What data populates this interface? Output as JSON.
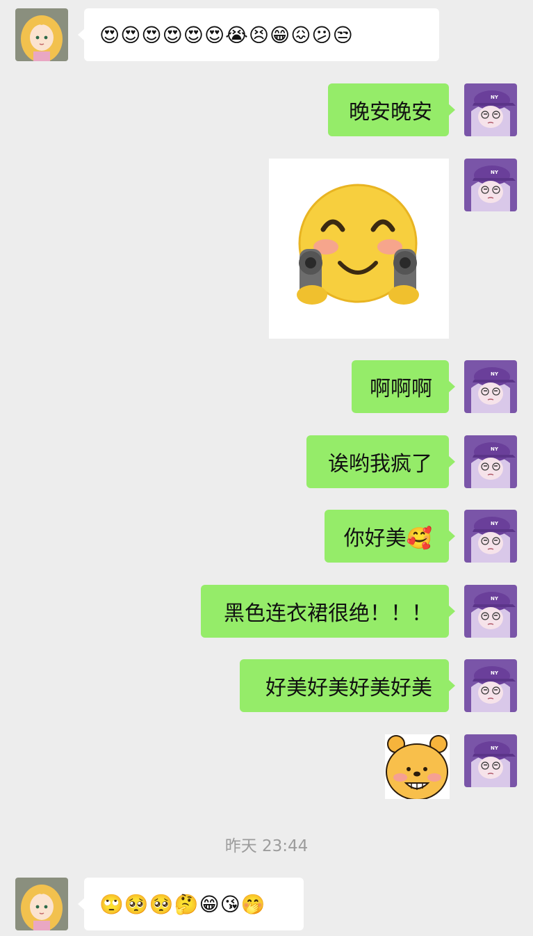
{
  "colors": {
    "background": "#ededed",
    "self_bubble": "#95ec69",
    "other_bubble": "#ffffff",
    "timestamp": "#9c9c9c"
  },
  "messages": [
    {
      "sender": "other",
      "type": "text",
      "text": "😍😍😍😍😍😍😭😣😁😖😕😒"
    },
    {
      "sender": "self",
      "type": "text",
      "text": "晚安晚安"
    },
    {
      "sender": "self",
      "type": "sticker",
      "sticker": "smiley-holding-guns-sticker"
    },
    {
      "sender": "self",
      "type": "text",
      "text": "啊啊啊"
    },
    {
      "sender": "self",
      "type": "text",
      "text": "诶哟我疯了"
    },
    {
      "sender": "self",
      "type": "text",
      "text": "你好美🥰"
    },
    {
      "sender": "self",
      "type": "text",
      "text": "黑色连衣裙很绝！！！"
    },
    {
      "sender": "self",
      "type": "text",
      "text": "好美好美好美好美"
    },
    {
      "sender": "self",
      "type": "sticker",
      "sticker": "bear-face-sticker"
    },
    {
      "sender": "other",
      "type": "text",
      "text": "🙄🥺🥺🤔😁😘🤭"
    }
  ],
  "timestamp": "昨天 23:44"
}
